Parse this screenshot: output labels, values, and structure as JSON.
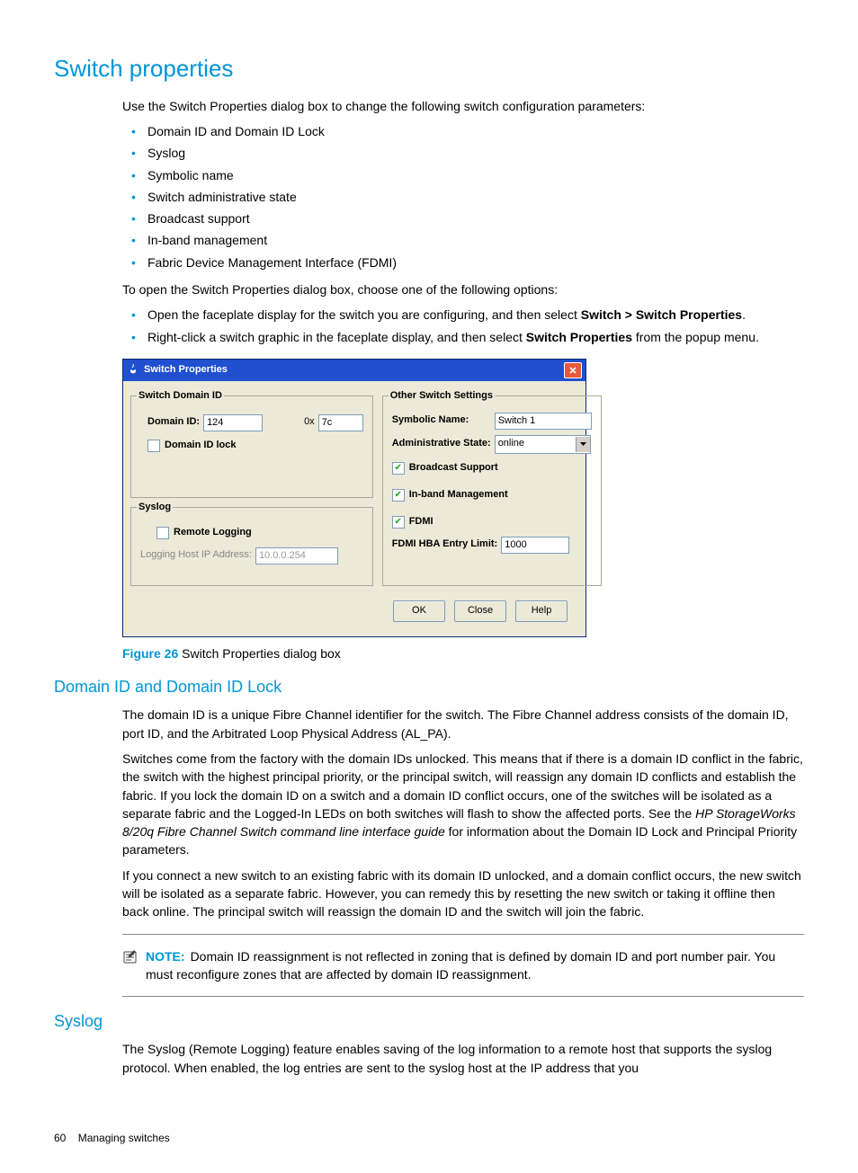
{
  "h1": "Switch properties",
  "intro": "Use the Switch Properties dialog box to change the following switch configuration parameters:",
  "bullets1": {
    "0": "Domain ID and Domain ID Lock",
    "1": "Syslog",
    "2": "Symbolic name",
    "3": "Switch administrative state",
    "4": "Broadcast support",
    "5": "In-band management",
    "6": "Fabric Device Management Interface (FDMI)"
  },
  "openIntro": "To open the Switch Properties dialog box, choose one of the following options:",
  "bullets2": {
    "0a": "Open the faceplate display for the switch you are configuring, and then select ",
    "0b": "Switch > Switch Properties",
    "0c": ".",
    "1a": "Right-click a switch graphic in the faceplate display, and then select ",
    "1b": "Switch Properties",
    "1c": " from the popup menu."
  },
  "dialog": {
    "title": "Switch Properties",
    "leftGroup1": {
      "legend": "Switch Domain ID",
      "domainIdLabel": "Domain ID:",
      "domainIdValue": "124",
      "hexPrefix": "0x",
      "hexValue": "7c",
      "lockLabel": "Domain ID lock",
      "lockChecked": false
    },
    "leftGroup2": {
      "legend": "Syslog",
      "remoteLabel": "Remote Logging",
      "remoteChecked": false,
      "hostLabel": "Logging Host IP Address:",
      "hostValue": "10.0.0.254"
    },
    "rightGroup": {
      "legend": "Other Switch Settings",
      "symbolicLabel": "Symbolic Name:",
      "symbolicValue": "Switch 1",
      "adminLabel": "Administrative State:",
      "adminValue": "online",
      "broadcastLabel": "Broadcast Support",
      "broadcastChecked": true,
      "inbandLabel": "In-band Management",
      "inbandChecked": true,
      "fdmiLabel": "FDMI",
      "fdmiChecked": true,
      "fdmiLimitLabel": "FDMI HBA Entry Limit:",
      "fdmiLimitValue": "1000"
    },
    "buttons": {
      "ok": "OK",
      "close": "Close",
      "help": "Help"
    }
  },
  "figure": {
    "label": "Figure 26",
    "caption": " Switch Properties dialog box"
  },
  "h2a": "Domain ID and Domain ID Lock",
  "domainPara1": "The domain ID is a unique Fibre Channel identifier for the switch. The Fibre Channel address consists of the domain ID, port ID, and the Arbitrated Loop Physical Address (AL_PA).",
  "domainPara2a": "Switches come from the factory with the domain IDs unlocked. This means that if there is a domain ID conflict in the fabric, the switch with the highest principal priority, or the principal switch, will reassign any domain ID conflicts and establish the fabric. If you lock the domain ID on a switch and a domain ID conflict occurs, one of the switches will be isolated as a separate fabric and the Logged-In LEDs on both switches will flash to show the affected ports. See the ",
  "domainPara2b": "HP StorageWorks 8/20q Fibre Channel Switch command line interface guide",
  "domainPara2c": " for information about the Domain ID Lock and Principal Priority parameters.",
  "domainPara3": "If you connect a new switch to an existing fabric with its domain ID unlocked, and a domain conflict occurs, the new switch will be isolated as a separate fabric. However, you can remedy this by resetting the new switch or taking it offline then back online. The principal switch will reassign the domain ID and the switch will join the fabric.",
  "note": {
    "label": "NOTE:",
    "text": "Domain ID reassignment is not reflected in zoning that is defined by domain ID and port number pair. You must reconfigure zones that are affected by domain ID reassignment."
  },
  "h2b": "Syslog",
  "syslogPara": "The Syslog (Remote Logging) feature enables saving of the log information to a remote host that supports the syslog protocol. When enabled, the log entries are sent to the syslog host at the IP address that you",
  "footer": {
    "page": "60",
    "section": "Managing switches"
  }
}
